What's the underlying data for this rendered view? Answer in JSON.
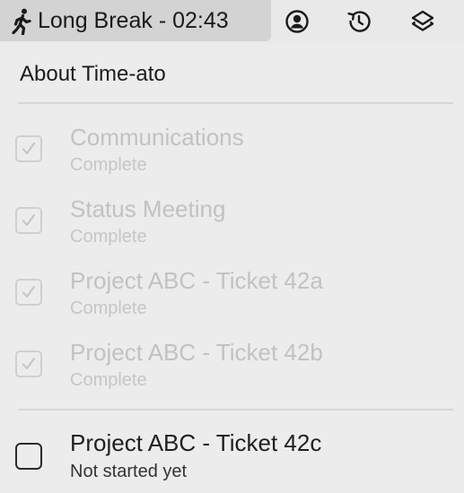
{
  "menubar": {
    "status_label": "Long Break - 02:43",
    "status_icon": "walking-person-icon",
    "icons": [
      "user-circle-icon",
      "history-icon",
      "layers-icon"
    ]
  },
  "menu": {
    "about_label": "About Time-ato",
    "tasks": [
      {
        "title": "Communications",
        "status": "Complete",
        "checked": true
      },
      {
        "title": "Status Meeting",
        "status": "Complete",
        "checked": true
      },
      {
        "title": "Project ABC - Ticket 42a",
        "status": "Complete",
        "checked": true
      },
      {
        "title": "Project ABC - Ticket 42b",
        "status": "Complete",
        "checked": true
      },
      {
        "title": "Project ABC - Ticket 42c",
        "status": "Not started yet",
        "checked": false
      }
    ]
  },
  "colors": {
    "menu_background": "#ececec",
    "status_highlight": "#d3d3d3",
    "completed_text": "#c2c2c2",
    "active_text": "#1f1f1f"
  }
}
